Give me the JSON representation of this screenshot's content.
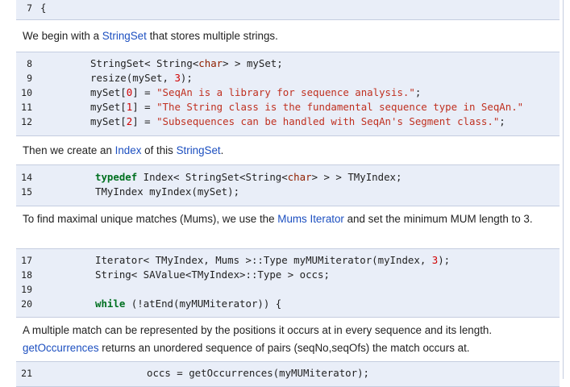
{
  "block0": {
    "lines": [
      {
        "num": "7",
        "parts": [
          {
            "t": "{",
            "c": ""
          }
        ]
      }
    ]
  },
  "p1": {
    "before": "We begin with a ",
    "link": "StringSet",
    "after": " that stores multiple strings."
  },
  "block1": {
    "lines": [
      {
        "num": "8",
        "parts": [
          {
            "t": "StringSet< String<",
            "c": ""
          },
          {
            "t": "char",
            "c": "ty"
          },
          {
            "t": "> > mySet;",
            "c": ""
          }
        ]
      },
      {
        "num": "9",
        "parts": [
          {
            "t": "resize(mySet, ",
            "c": ""
          },
          {
            "t": "3",
            "c": "num"
          },
          {
            "t": ");",
            "c": ""
          }
        ]
      },
      {
        "num": "10",
        "parts": [
          {
            "t": "mySet[",
            "c": ""
          },
          {
            "t": "0",
            "c": "num"
          },
          {
            "t": "] = ",
            "c": ""
          },
          {
            "t": "\"SeqAn is a library for sequence analysis.\"",
            "c": "str"
          },
          {
            "t": ";",
            "c": ""
          }
        ]
      },
      {
        "num": "11",
        "parts": [
          {
            "t": "mySet[",
            "c": ""
          },
          {
            "t": "1",
            "c": "num"
          },
          {
            "t": "] = ",
            "c": ""
          },
          {
            "t": "\"The String class is the fundamental sequence type in SeqAn.\"",
            "c": "str"
          }
        ]
      },
      {
        "num": "12",
        "parts": [
          {
            "t": "mySet[",
            "c": ""
          },
          {
            "t": "2",
            "c": "num"
          },
          {
            "t": "] = ",
            "c": ""
          },
          {
            "t": "\"Subsequences can be handled with SeqAn's Segment class.\"",
            "c": "str"
          },
          {
            "t": ";",
            "c": ""
          }
        ]
      }
    ]
  },
  "p2": {
    "before": "Then we create an ",
    "link1": "Index",
    "middle": " of this ",
    "link2": "StringSet",
    "after": "."
  },
  "block2": {
    "lines": [
      {
        "num": "14",
        "parts": [
          {
            "t": "typedef",
            "c": "kw"
          },
          {
            "t": " Index< StringSet<String<",
            "c": ""
          },
          {
            "t": "char",
            "c": "ty"
          },
          {
            "t": "> > > TMyIndex;",
            "c": ""
          }
        ]
      },
      {
        "num": "15",
        "parts": [
          {
            "t": "TMyIndex myIndex(mySet);",
            "c": ""
          }
        ]
      }
    ]
  },
  "p3": {
    "before": "To find maximal unique matches (Mums), we use the ",
    "link": "Mums Iterator",
    "after": " and set the minimum MUM length to 3."
  },
  "block3": {
    "lines": [
      {
        "num": "17",
        "parts": [
          {
            "t": "Iterator< TMyIndex, Mums >::Type myMUMiterator(myIndex, ",
            "c": ""
          },
          {
            "t": "3",
            "c": "num"
          },
          {
            "t": ");",
            "c": ""
          }
        ]
      },
      {
        "num": "18",
        "parts": [
          {
            "t": "String< SAValue<TMyIndex>::Type > occs;",
            "c": ""
          }
        ]
      },
      {
        "num": "19",
        "parts": []
      },
      {
        "num": "20",
        "parts": [
          {
            "t": "while",
            "c": "kw"
          },
          {
            "t": " (!atEnd(myMUMiterator)) {",
            "c": ""
          }
        ]
      }
    ]
  },
  "p4": {
    "line1": "A multiple match can be represented by the positions it occurs at in every sequence and its length.",
    "link": "getOccurrences",
    "line2": " returns an unordered sequence of pairs (seqNo,seqOfs) the match occurs at."
  },
  "block4": {
    "lines": [
      {
        "num": "21",
        "parts": [
          {
            "t": "occs = getOccurrences(myMUMiterator);",
            "c": ""
          }
        ]
      }
    ]
  }
}
